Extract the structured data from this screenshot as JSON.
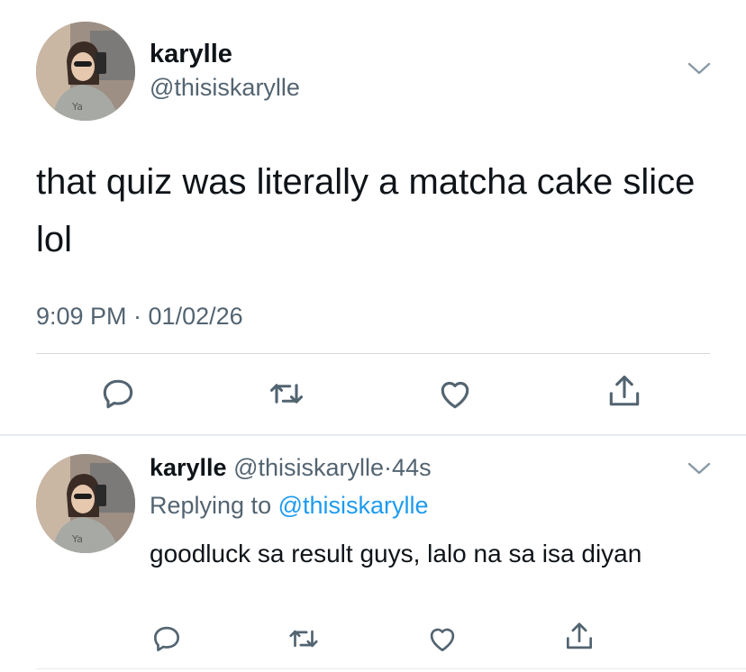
{
  "colors": {
    "text": "#0f1419",
    "secondary": "#536471",
    "link": "#1d9bf0",
    "divider": "#d4d9de",
    "icon": "#536471"
  },
  "main_tweet": {
    "display_name": "karylle",
    "handle": "@thisiskarylle",
    "text": "that quiz was literally a matcha cake slice lol",
    "timestamp": "9:09 PM · 01/02/26",
    "menu_icon": "chevron-down-icon",
    "actions": [
      "reply-icon",
      "retweet-icon",
      "like-icon",
      "share-icon"
    ]
  },
  "reply_tweet": {
    "display_name": "karylle",
    "handle": "@thisiskarylle",
    "separator": "·",
    "age": "44s",
    "replying_prefix": "Replying to",
    "replying_handle": "@thisiskarylle",
    "text": "goodluck sa result guys, lalo na sa isa diyan",
    "menu_icon": "chevron-down-icon",
    "actions": [
      "reply-icon",
      "retweet-icon",
      "like-icon",
      "share-icon"
    ]
  }
}
